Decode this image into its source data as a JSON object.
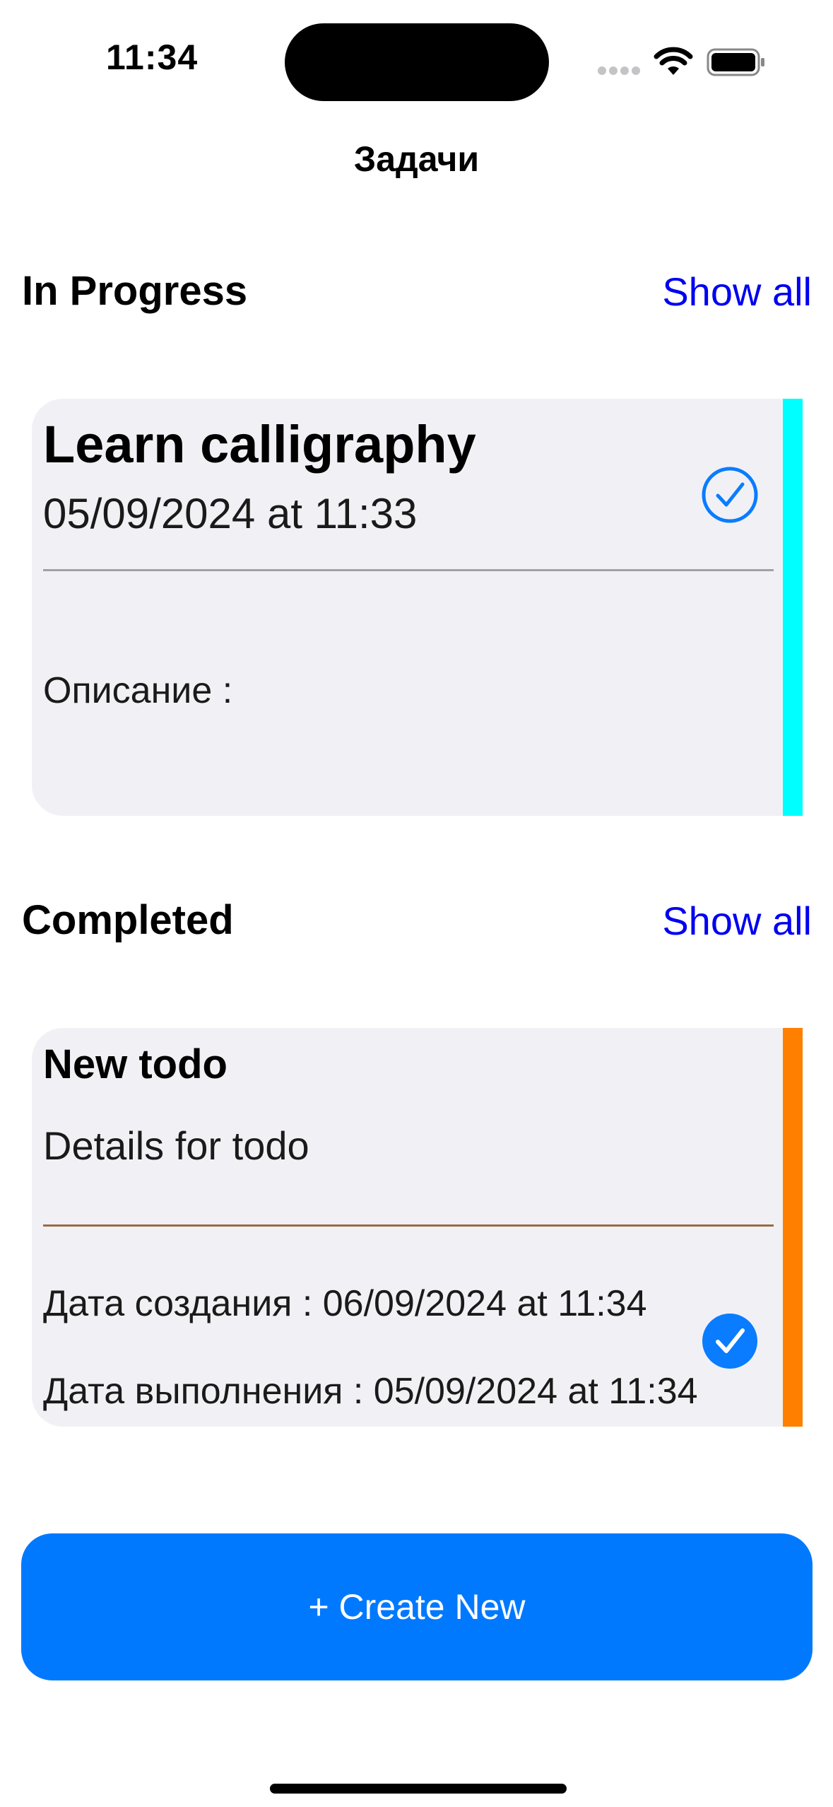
{
  "status_bar": {
    "time": "11:34"
  },
  "nav": {
    "title": "Задачи"
  },
  "in_progress": {
    "title": "In Progress",
    "show_all": "Show all",
    "card": {
      "title": "Learn calligraphy",
      "date": "05/09/2024 at 11:33",
      "description": "Описание :",
      "stripe_color": "#00ffff",
      "check_state": "outline"
    }
  },
  "completed": {
    "title": "Completed",
    "show_all": "Show all",
    "card": {
      "title": "New todo",
      "details": "Details for todo",
      "created": "Дата создания : 06/09/2024 at 11:34",
      "done": "Дата выполнения : 05/09/2024 at 11:34",
      "stripe_color": "#ff8000",
      "check_state": "filled"
    }
  },
  "create_button": {
    "label": "+ Create New"
  },
  "colors": {
    "accent": "#0079ff",
    "link": "#0000f0",
    "card_bg": "#f1f1f5"
  },
  "icons": [
    "wifi-icon",
    "battery-icon",
    "checkmark-circle-icon",
    "checkmark-circle-filled-icon"
  ]
}
